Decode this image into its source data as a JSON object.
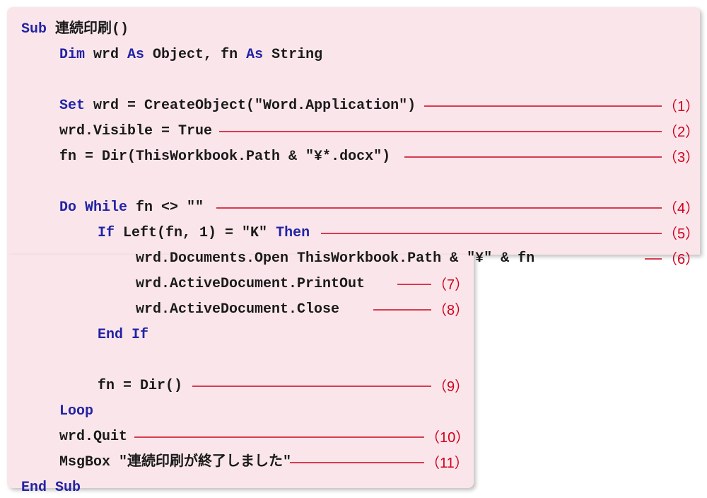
{
  "code": {
    "l1_sub": "Sub",
    "l1_name": " 連続印刷()",
    "l2_dim": "Dim",
    "l2_body": " wrd ",
    "l2_as1": "As",
    "l2_body2": " Object, fn ",
    "l2_as2": "As",
    "l2_body3": " String",
    "l4_set": "Set",
    "l4_body": " wrd = CreateObject(\"Word.Application\")",
    "l5": "wrd.Visible = True",
    "l6": "fn = Dir(ThisWorkbook.Path & \"¥*.docx\")",
    "l8_do": "Do While",
    "l8_body": " fn <> \"\"",
    "l9_if": "If",
    "l9_body": " Left(fn, 1) = \"K\" ",
    "l9_then": "Then",
    "l10": "wrd.Documents.Open ThisWorkbook.Path & \"¥\" & fn",
    "l11": "wrd.ActiveDocument.PrintOut",
    "l12": "wrd.ActiveDocument.Close",
    "l13_end": "End If",
    "l15": "fn = Dir()",
    "l16_loop": "Loop",
    "l18": "wrd.Quit",
    "l19": "MsgBox \"連続印刷が終了しました\"",
    "l20_end": "End Sub"
  },
  "callouts": {
    "n1": "（1）",
    "n2": "（2）",
    "n3": "（3）",
    "n4": "（4）",
    "n5": "（5）",
    "n6": "（6）",
    "n7": "（7）",
    "n8": "（8）",
    "n9": "（9）",
    "n10": "（10）",
    "n11": "（11）"
  }
}
